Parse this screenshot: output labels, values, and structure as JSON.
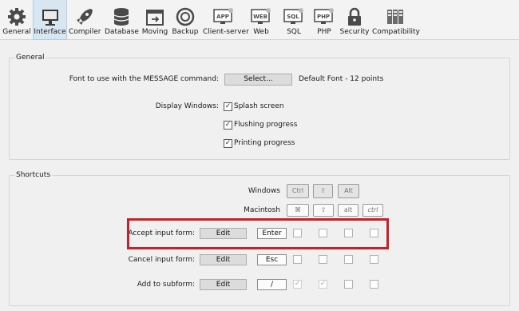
{
  "toolbar": {
    "items": [
      {
        "label": "General",
        "icon": "gear-icon"
      },
      {
        "label": "Interface",
        "icon": "monitor-icon"
      },
      {
        "label": "Compiler",
        "icon": "rocket-icon"
      },
      {
        "label": "Database",
        "icon": "database-icon"
      },
      {
        "label": "Moving",
        "icon": "moving-icon"
      },
      {
        "label": "Backup",
        "icon": "backup-icon"
      },
      {
        "label": "Client-server",
        "icon": "client-server-icon"
      },
      {
        "label": "Web",
        "icon": "web-icon"
      },
      {
        "label": "SQL",
        "icon": "sql-icon"
      },
      {
        "label": "PHP",
        "icon": "php-icon"
      },
      {
        "label": "Security",
        "icon": "lock-icon"
      },
      {
        "label": "Compatibility",
        "icon": "compatibility-icon"
      }
    ],
    "icon_text": {
      "app": "APP",
      "web": "WEB",
      "sql": "SQL",
      "php": "PHP"
    },
    "active_index": 1
  },
  "general": {
    "title": "General",
    "font_label": "Font to use with the MESSAGE command:",
    "select_button": "Select...",
    "font_value": "Default Font - 12 points",
    "display_label": "Display Windows:",
    "options": [
      {
        "label": "Splash screen",
        "checked": true
      },
      {
        "label": "Flushing progress",
        "checked": true
      },
      {
        "label": "Printing progress",
        "checked": true
      }
    ]
  },
  "shortcuts": {
    "title": "Shortcuts",
    "windows_label": "Windows",
    "mac_label": "Macintosh",
    "windows_keys": [
      "Ctrl",
      "⇧",
      "Alt"
    ],
    "mac_keys": [
      "⌘",
      "⇧",
      "alt",
      "ctrl"
    ],
    "edit_label": "Edit",
    "rows": [
      {
        "label": "Accept input form:",
        "key": "Enter",
        "checks": [
          false,
          false,
          false,
          false
        ]
      },
      {
        "label": "Cancel input form:",
        "key": "Esc",
        "checks": [
          false,
          false,
          false,
          false
        ]
      },
      {
        "label": "Add to subform:",
        "key": "/",
        "checks": [
          true,
          true,
          false,
          false
        ]
      }
    ]
  },
  "colors": {
    "highlight": "#c8202a",
    "active_tab": "#d8e6f2"
  }
}
